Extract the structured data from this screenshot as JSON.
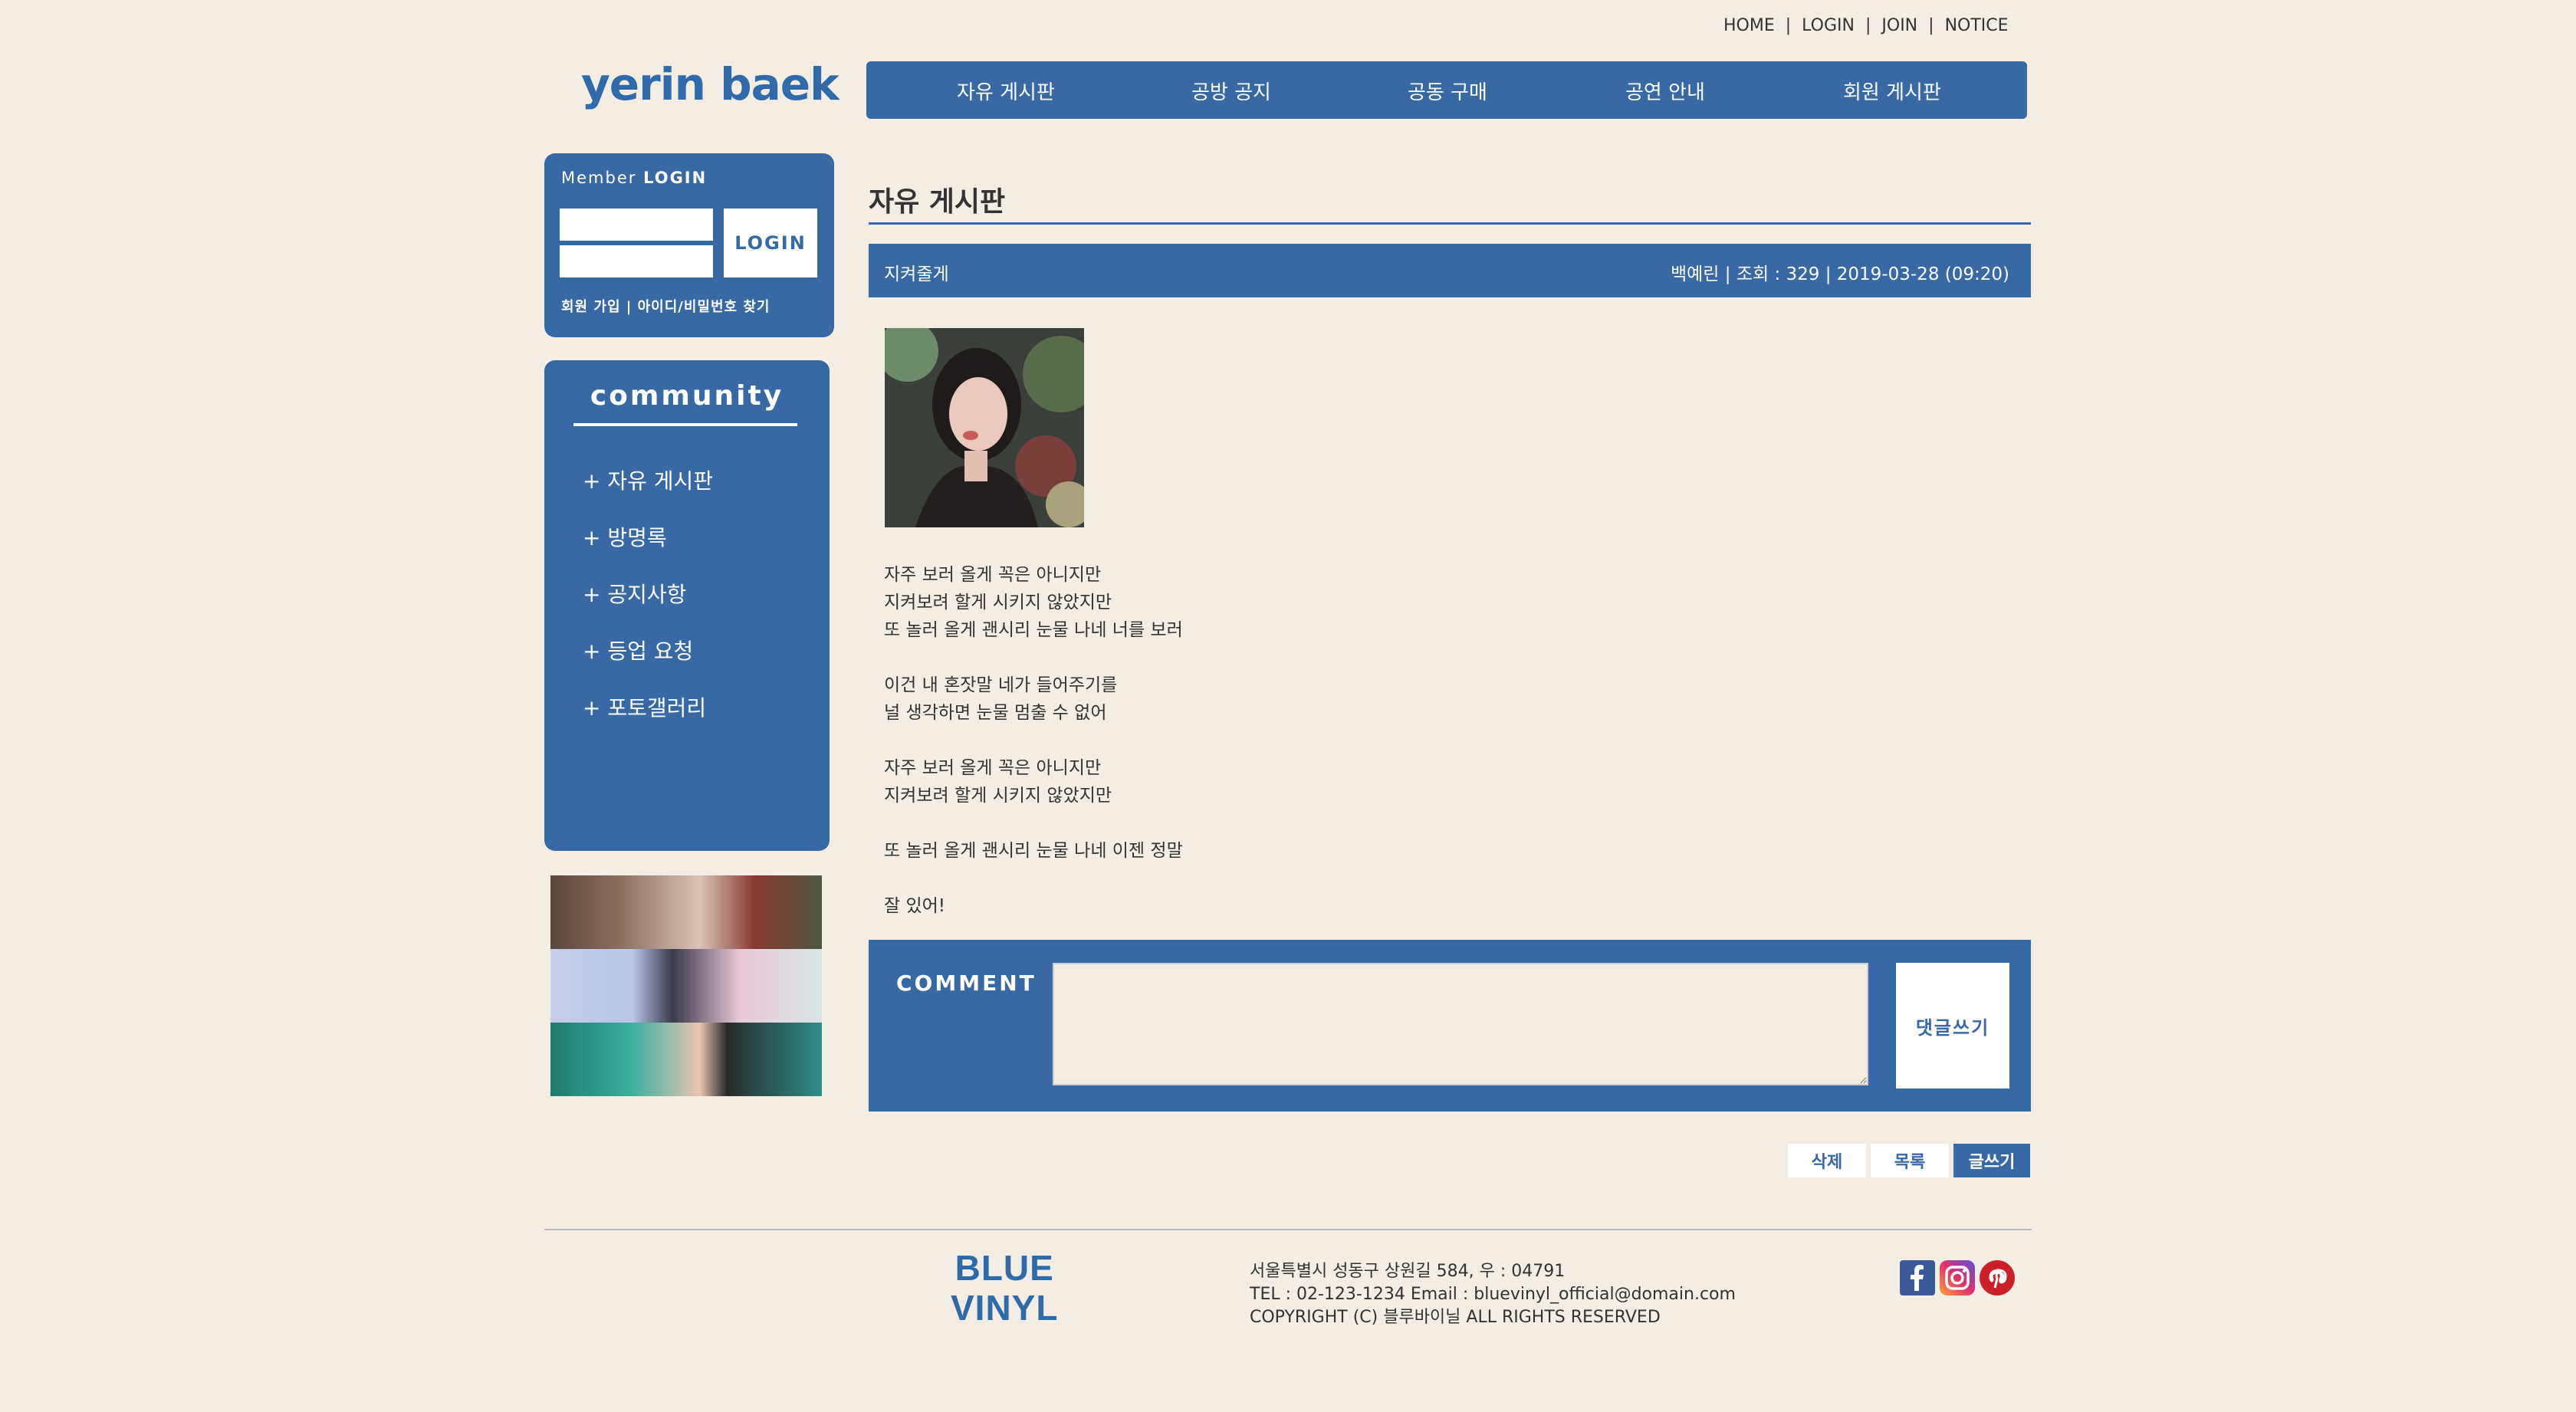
{
  "top_links": [
    "HOME",
    "LOGIN",
    "JOIN",
    "NOTICE"
  ],
  "top_sep": "|",
  "logo": "yerin baek",
  "nav": [
    "자유 게시판",
    "공방 공지",
    "공동 구매",
    "공연 안내",
    "회원 게시판"
  ],
  "login": {
    "title_prefix": "Member",
    "title_bold": "LOGIN",
    "button": "LOGIN",
    "links": "회원 가입  |  아이디/비밀번호 찾기"
  },
  "community": {
    "title": "community",
    "items": [
      "+ 자유 게시판",
      "+ 방명록",
      "+ 공지사항",
      "+ 등업 요청",
      "+ 포토갤러리"
    ]
  },
  "board": {
    "title": "자유 게시판",
    "post_title": "지켜줄게",
    "meta": "백예린  |  조회 : 329  |  2019-03-28 (09:20)",
    "body": [
      "자주 보러 올게 꼭은 아니지만",
      "지켜보려 할게 시키지 않았지만",
      "또 놀러 올게 괜시리 눈물 나네 너를 보러",
      "",
      "이건 내 혼잣말 네가 들어주기를",
      "널 생각하면 눈물 멈출 수 없어",
      "",
      "자주 보러 올게 꼭은 아니지만",
      "지켜보려 할게 시키지 않았지만",
      "",
      "또 놀러 올게 괜시리 눈물 나네 이젠 정말",
      "",
      "잘 있어!"
    ]
  },
  "comment": {
    "label": "COMMENT",
    "button": "댓글쓰기"
  },
  "actions": [
    "삭제",
    "목록",
    "글쓰기"
  ],
  "footer": {
    "logo_line1": "BLUE",
    "logo_line2": "VINYL",
    "address": "서울특별시 성동구 상원길 584, 우 : 04791",
    "contact": "TEL : 02-123-1234 Email : bluevinyl_official@domain.com",
    "copyright": "COPYRIGHT (C) 블루바이닐 ALL RIGHTS RESERVED"
  },
  "icons": {
    "facebook": "facebook-icon",
    "instagram": "instagram-icon",
    "pinterest": "pinterest-icon"
  },
  "colors": {
    "background": "#f3ede3",
    "primary": "#3769a5",
    "logo": "#2f6aaa"
  }
}
